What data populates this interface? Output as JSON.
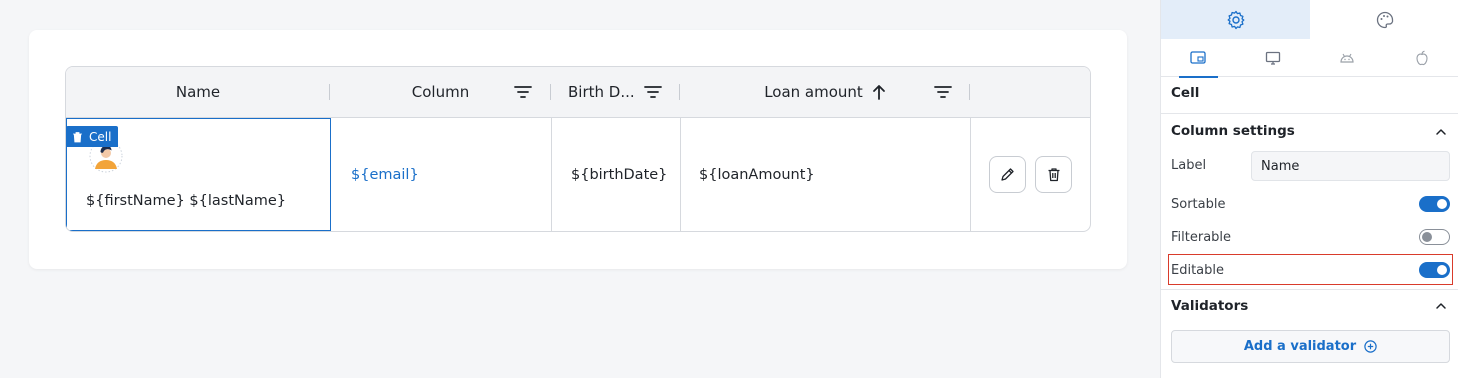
{
  "table": {
    "columns": [
      {
        "label": "Name"
      },
      {
        "label": "Column"
      },
      {
        "label": "Birth D..."
      },
      {
        "label": "Loan amount"
      }
    ],
    "row": {
      "name": "${firstName} ${lastName}",
      "email": "${email}",
      "birth_date": "${birthDate}",
      "loan_amount": "${loanAmount}"
    },
    "cell_tag": "Cell"
  },
  "panel": {
    "tabs": [
      {
        "icon": "gear-icon"
      },
      {
        "icon": "palette-icon"
      }
    ],
    "devices": [
      {
        "icon": "tablet-icon"
      },
      {
        "icon": "desktop-icon"
      },
      {
        "icon": "android-icon"
      },
      {
        "icon": "apple-icon"
      }
    ],
    "component_title": "Cell",
    "column_settings": {
      "title": "Column settings",
      "label_field": "Label",
      "label_value": "Name",
      "sortable": {
        "label": "Sortable",
        "on": true
      },
      "filterable": {
        "label": "Filterable",
        "on": false
      },
      "editable": {
        "label": "Editable",
        "on": true
      }
    },
    "validators": {
      "title": "Validators",
      "add_label": "Add a validator"
    }
  },
  "colors": {
    "accent": "#1a6fc9",
    "highlight": "#d93b2b"
  }
}
